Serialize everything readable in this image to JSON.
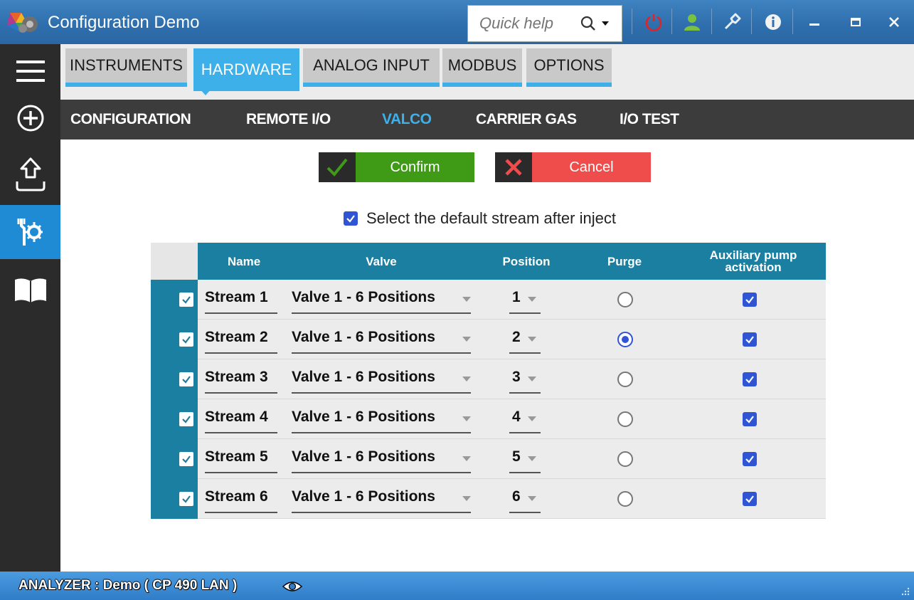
{
  "window": {
    "title": "Configuration Demo",
    "quick_help_placeholder": "Quick help",
    "buttons": [
      "power-icon",
      "user-icon",
      "wrench-icon",
      "info-icon",
      "minimize-icon",
      "maximize-icon",
      "close-icon"
    ]
  },
  "rail": {
    "items": [
      "menu-icon",
      "add-circle-icon",
      "upload-icon",
      "tools-icon",
      "book-icon"
    ],
    "active": "tools-icon"
  },
  "tabs": {
    "items": [
      {
        "label": "INSTRUMENTS"
      },
      {
        "label": "HARDWARE"
      },
      {
        "label": "ANALOG INPUT"
      },
      {
        "label": "MODBUS"
      },
      {
        "label": "OPTIONS"
      }
    ],
    "active": "HARDWARE"
  },
  "subnav": {
    "items": [
      {
        "label": "CONFIGURATION"
      },
      {
        "label": "REMOTE I/O"
      },
      {
        "label": "VALCO"
      },
      {
        "label": "CARRIER GAS"
      },
      {
        "label": "I/O TEST"
      }
    ],
    "active": "VALCO"
  },
  "actions": {
    "confirm_label": "Confirm",
    "cancel_label": "Cancel"
  },
  "option": {
    "label": "Select the default stream after inject",
    "checked": true
  },
  "table": {
    "headers": {
      "name": "Name",
      "valve": "Valve",
      "position": "Position",
      "purge": "Purge",
      "aux": "Auxiliary pump activation"
    },
    "rows": [
      {
        "name": "Stream 1",
        "valve": "Valve 1 - 6 Positions",
        "position": "1",
        "purge": false,
        "aux": true,
        "selected": true
      },
      {
        "name": "Stream 2",
        "valve": "Valve 1 - 6 Positions",
        "position": "2",
        "purge": true,
        "aux": true,
        "selected": true
      },
      {
        "name": "Stream 3",
        "valve": "Valve 1 - 6 Positions",
        "position": "3",
        "purge": false,
        "aux": true,
        "selected": true
      },
      {
        "name": "Stream 4",
        "valve": "Valve 1 - 6 Positions",
        "position": "4",
        "purge": false,
        "aux": true,
        "selected": true
      },
      {
        "name": "Stream 5",
        "valve": "Valve 1 - 6 Positions",
        "position": "5",
        "purge": false,
        "aux": true,
        "selected": true
      },
      {
        "name": "Stream 6",
        "valve": "Valve 1 - 6 Positions",
        "position": "6",
        "purge": false,
        "aux": true,
        "selected": true
      }
    ]
  },
  "status": {
    "text": "ANALYZER :  Demo ( CP 490 LAN )"
  },
  "colors": {
    "accent": "#3db0ea",
    "table_header": "#1a7fa0",
    "confirm": "#3f9b16",
    "cancel": "#ef4c4c",
    "check": "#2f55d4"
  }
}
